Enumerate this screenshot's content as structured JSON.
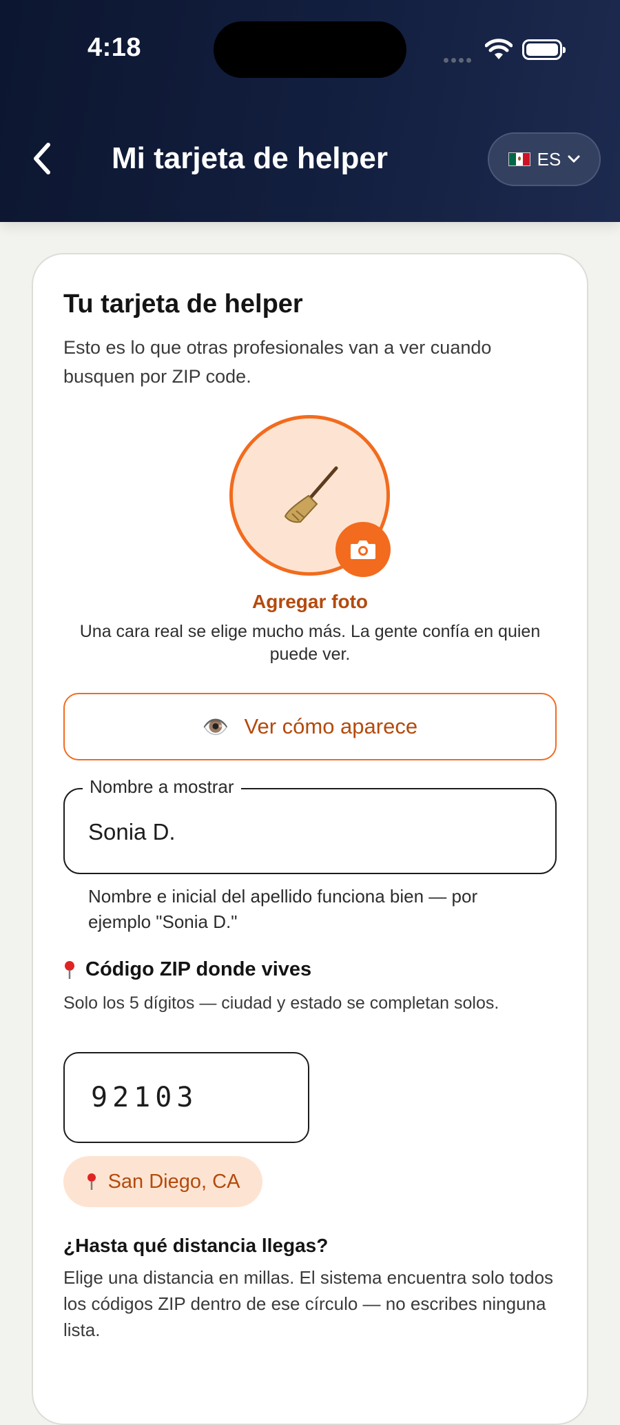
{
  "status_bar": {
    "time": "4:18"
  },
  "header": {
    "title": "Mi tarjeta de helper",
    "language": "ES",
    "language_flag": "mexico-flag"
  },
  "card": {
    "title": "Tu tarjeta de helper",
    "subtitle": "Esto es lo que otras profesionales van a ver cuando busquen por ZIP code.",
    "avatar_placeholder": "🧹",
    "add_photo_label": "Agregar foto",
    "photo_hint": "Una cara real se elige mucho más. La gente confía en quien puede ver.",
    "preview_button": {
      "icon": "👁️",
      "label": "Ver cómo aparece"
    },
    "display_name": {
      "legend": "Nombre a mostrar",
      "value": "Sonia D.",
      "hint": "Nombre e inicial del apellido funciona bien — por ejemplo \"Sonia D.\""
    },
    "zip": {
      "label": "Código ZIP donde vives",
      "hint": "Solo los 5 dígitos — ciudad y estado se completan solos.",
      "value": "92103",
      "city": "San Diego, CA"
    },
    "distance": {
      "title": "¿Hasta qué distancia llegas?",
      "hint": "Elige una distancia en millas. El sistema encuentra solo todos los códigos ZIP dentro de ese círculo — no escribes ninguna lista."
    }
  },
  "colors": {
    "accent": "#f26b1e",
    "accent_text": "#b44a0d",
    "header_bg": "#131f3f",
    "chip_bg": "#fde4d2"
  }
}
